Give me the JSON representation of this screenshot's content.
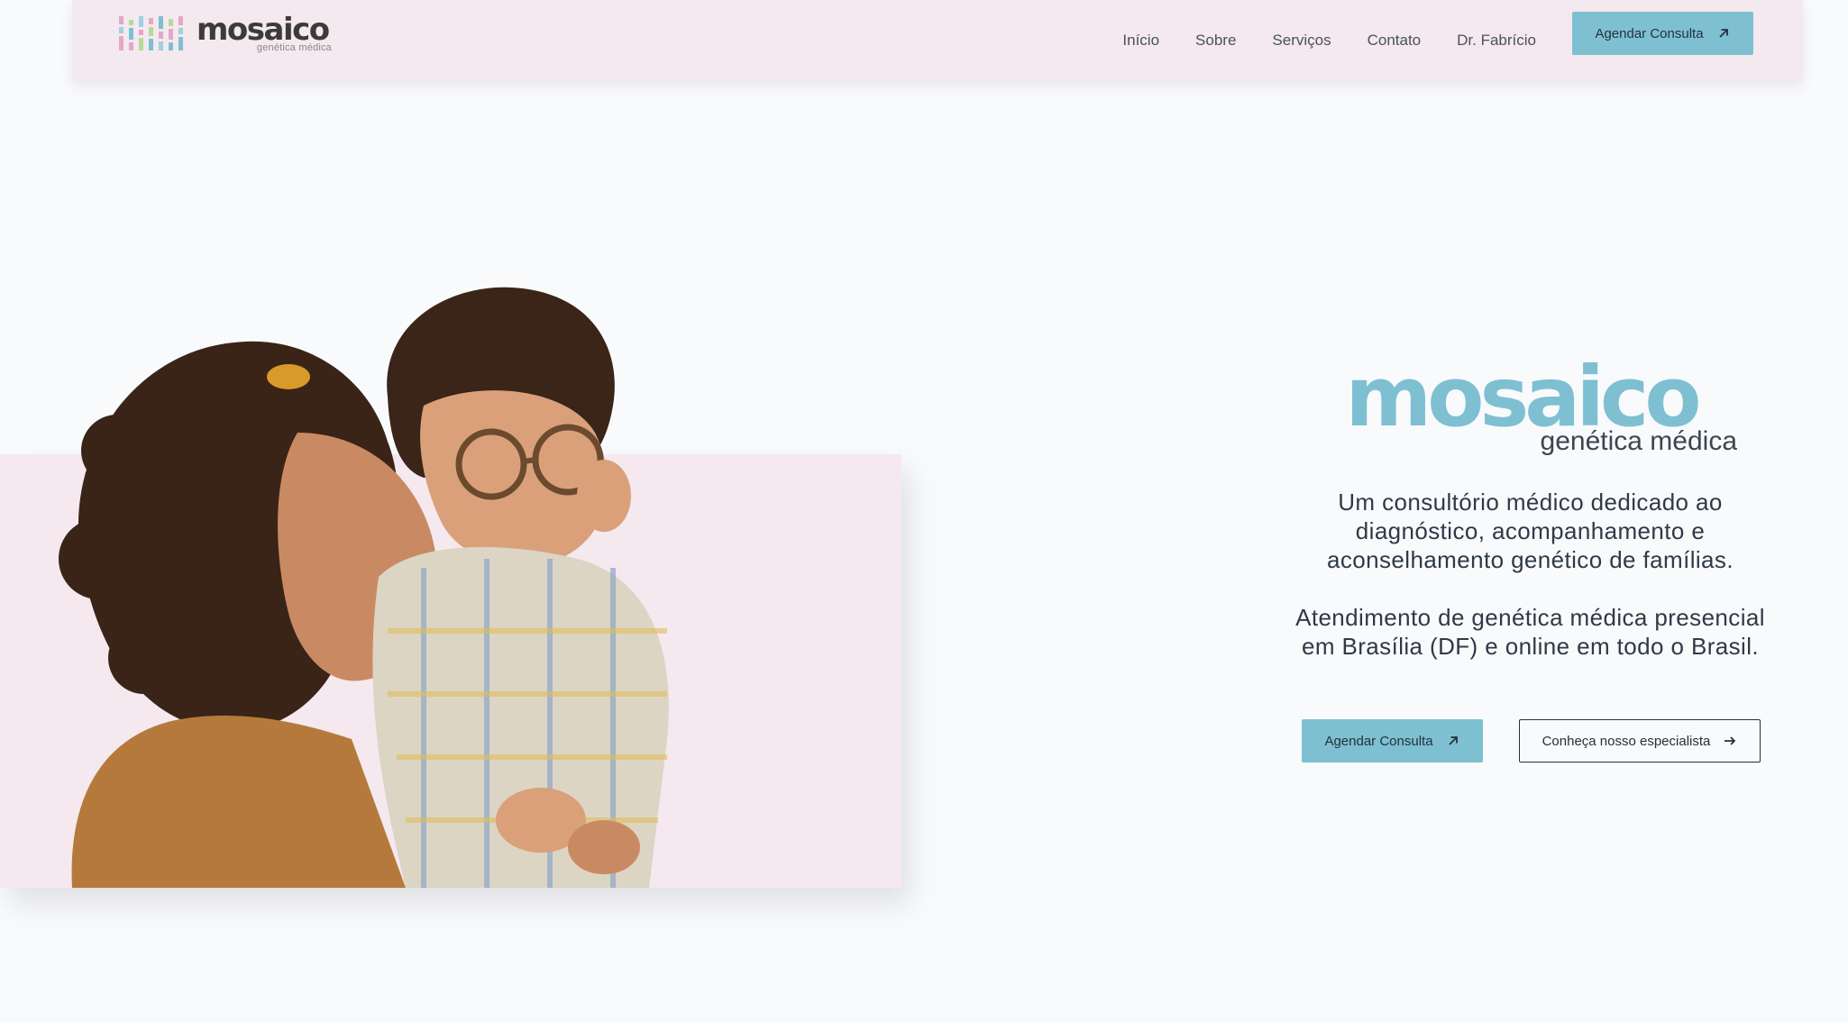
{
  "header": {
    "logo_word": "mosaico",
    "logo_sub": "genética médica",
    "nav": [
      {
        "label": "Início"
      },
      {
        "label": "Sobre"
      },
      {
        "label": "Serviços"
      },
      {
        "label": "Contato"
      },
      {
        "label": "Dr. Fabrício"
      }
    ],
    "cta_label": "Agendar Consulta",
    "cta_icon": "arrow-up-right-icon"
  },
  "hero": {
    "brand_word": "mosaico",
    "brand_sub": "genética médica",
    "tagline_1": "Um consultório médico dedicado ao diagnóstico, acompanhamento e aconselhamento genético de famílias.",
    "tagline_2": "Atendimento de genética médica presencial em Brasília (DF) e online em todo o Brasil.",
    "primary_label": "Agendar Consulta",
    "primary_icon": "arrow-up-right-icon",
    "secondary_label": "Conheça nosso especialista",
    "secondary_icon": "arrow-right-icon",
    "image_subject": "mother-and-child-photo"
  },
  "colors": {
    "accent": "#7ec0d2",
    "header_bg": "#f3e9ee",
    "panel_bg": "#f5e8ef",
    "page_bg": "#f9fafc"
  }
}
